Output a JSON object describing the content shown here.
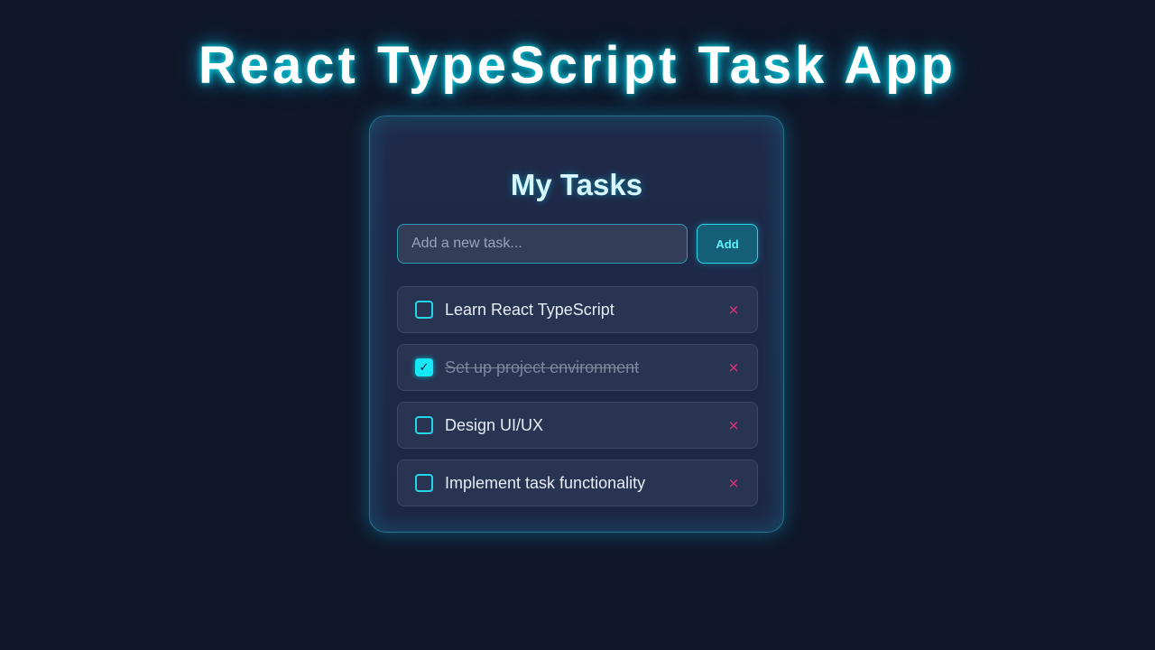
{
  "app": {
    "title": "React TypeScript Task App"
  },
  "card": {
    "title": "My Tasks"
  },
  "input": {
    "placeholder": "Add a new task...",
    "value": ""
  },
  "add_button": {
    "label": "Add"
  },
  "tasks": [
    {
      "label": "Learn React TypeScript",
      "completed": false,
      "check_glyph": "",
      "delete_glyph": "×"
    },
    {
      "label": "Set up project environment",
      "completed": true,
      "check_glyph": "✓",
      "delete_glyph": "×"
    },
    {
      "label": "Design UI/UX",
      "completed": false,
      "check_glyph": "",
      "delete_glyph": "×"
    },
    {
      "label": "Implement task functionality",
      "completed": false,
      "check_glyph": "",
      "delete_glyph": "×"
    }
  ],
  "icons": {
    "checkbox": "checkbox-icon",
    "checkmark": "checkmark-icon",
    "delete": "close-icon"
  },
  "colors": {
    "background": "#10172a",
    "card": "#1f2a49",
    "accent": "#16e6f5",
    "delete": "#e8347b",
    "completed_text": "#7b879d"
  }
}
